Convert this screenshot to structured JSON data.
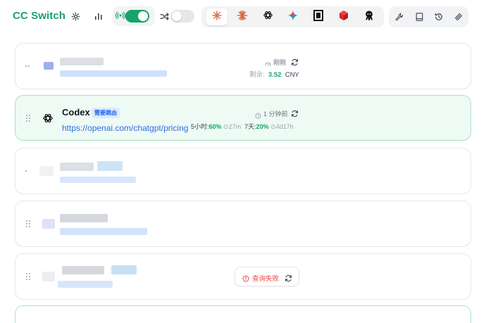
{
  "app": {
    "title": "CC Switch"
  },
  "header": {
    "icons": [
      "gear-icon",
      "bar-chart-icon",
      "broadcast-icon",
      "shuffle-icon"
    ],
    "proxy_toggle": {
      "on": true
    },
    "failover_toggle": {
      "on": false
    },
    "apps": [
      "claude",
      "claude-alt",
      "openai",
      "gemini",
      "opencode",
      "cube",
      "octopus"
    ],
    "active_app": "claude",
    "tools": [
      "wrench-icon",
      "book-icon",
      "history-icon",
      "stack-icon"
    ]
  },
  "cards": [
    {
      "refresh_time": "刚刚",
      "balance_label": "剩余:",
      "balance_value": "3.52",
      "balance_unit": "CNY"
    },
    {
      "name": "Codex",
      "badge": "需要跳由",
      "url": "https://openai.com/chatgpt/pricing",
      "refresh_time": "1 分钟前",
      "usage": {
        "five_hour_label": "5小时:",
        "five_hour_pct": "60%",
        "five_hour_reset": "27m",
        "seven_day_label": "7天:",
        "seven_day_pct": "20%",
        "seven_day_reset": "4d17h"
      }
    },
    {},
    {},
    {
      "error_label": "查询失败"
    }
  ],
  "colors": {
    "accent": "#16a36a",
    "link": "#2f6fe0",
    "error": "#ef4444",
    "active_card_bg": "#eefaf4"
  }
}
